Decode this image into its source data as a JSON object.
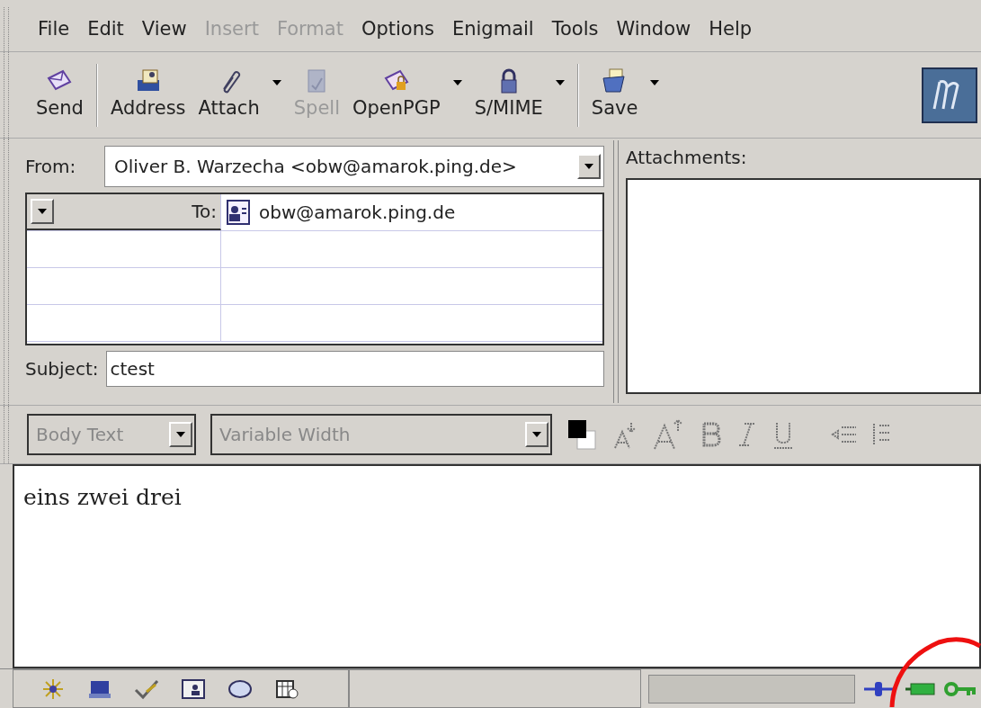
{
  "menu": [
    {
      "label": "File",
      "disabled": false
    },
    {
      "label": "Edit",
      "disabled": false
    },
    {
      "label": "View",
      "disabled": false
    },
    {
      "label": "Insert",
      "disabled": true
    },
    {
      "label": "Format",
      "disabled": true
    },
    {
      "label": "Options",
      "disabled": false
    },
    {
      "label": "Enigmail",
      "disabled": false
    },
    {
      "label": "Tools",
      "disabled": false
    },
    {
      "label": "Window",
      "disabled": false
    },
    {
      "label": "Help",
      "disabled": false
    }
  ],
  "toolbar": [
    {
      "kind": "send",
      "label": "Send",
      "disabled": false,
      "dropdown": false
    },
    {
      "kind": "address",
      "label": "Address",
      "disabled": false,
      "dropdown": false
    },
    {
      "kind": "attach",
      "label": "Attach",
      "disabled": false,
      "dropdown": true
    },
    {
      "kind": "spell",
      "label": "Spell",
      "disabled": true,
      "dropdown": false
    },
    {
      "kind": "openpgp",
      "label": "OpenPGP",
      "disabled": false,
      "dropdown": true
    },
    {
      "kind": "smime",
      "label": "S/MIME",
      "disabled": false,
      "dropdown": true
    },
    {
      "kind": "save",
      "label": "Save",
      "disabled": false,
      "dropdown": true
    }
  ],
  "from": {
    "label": "From:",
    "value": "Oliver B. Warzecha <obw@amarok.ping.de>"
  },
  "recipients": [
    {
      "type": "To:",
      "address": "obw@amarok.ping.de"
    }
  ],
  "subject": {
    "label": "Subject:",
    "value": "ctest"
  },
  "attachments": {
    "label": "Attachments:"
  },
  "format_bar": {
    "paragraph": "Body Text",
    "font": "Variable Width"
  },
  "body": "eins zwei drei"
}
